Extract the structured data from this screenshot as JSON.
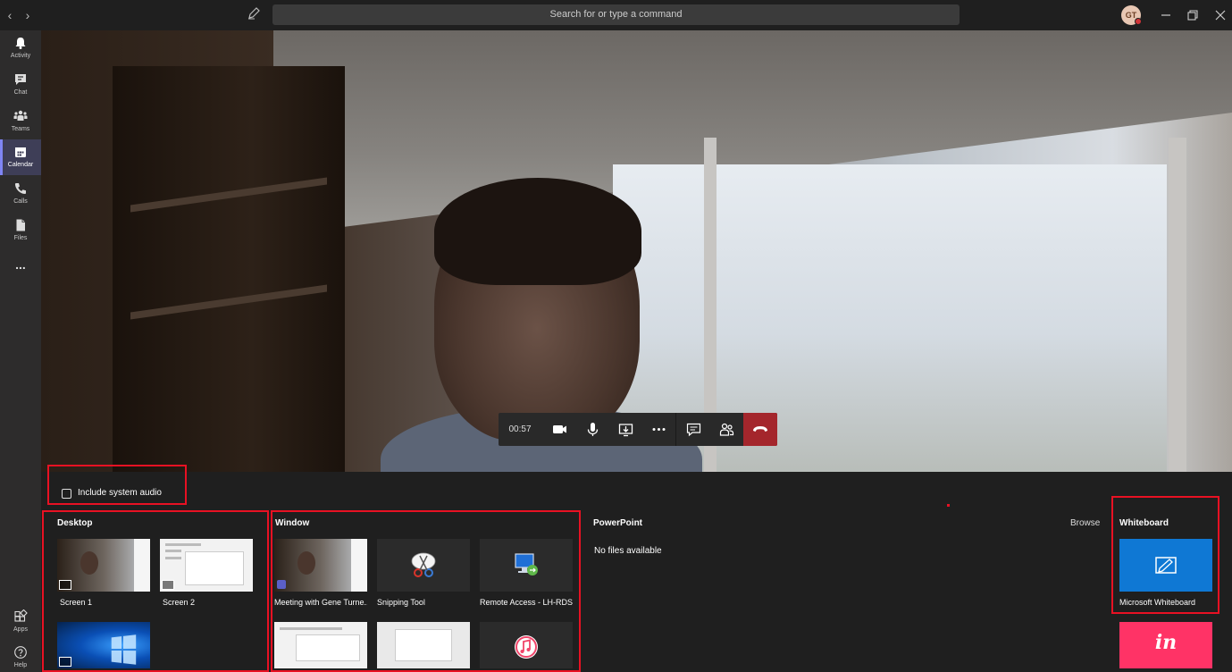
{
  "topbar": {
    "search_placeholder": "Search for or type a command",
    "avatar_initials": "GT"
  },
  "rail": {
    "items": [
      {
        "label": "Activity",
        "active": false
      },
      {
        "label": "Chat",
        "active": false
      },
      {
        "label": "Teams",
        "active": false
      },
      {
        "label": "Calendar",
        "active": true
      },
      {
        "label": "Calls",
        "active": false
      },
      {
        "label": "Files",
        "active": false
      }
    ],
    "more_label": "...",
    "apps_label": "Apps",
    "help_label": "Help"
  },
  "call": {
    "timer": "00:57"
  },
  "share": {
    "include_audio_label": "Include system audio",
    "desktop": {
      "title": "Desktop",
      "items": [
        {
          "label": "Screen 1"
        },
        {
          "label": "Screen 2"
        },
        {
          "label": ""
        }
      ]
    },
    "window": {
      "title": "Window",
      "items": [
        {
          "label": "Meeting with Gene Turne..."
        },
        {
          "label": "Snipping Tool"
        },
        {
          "label": "Remote Access - LH-RDS..."
        }
      ]
    },
    "powerpoint": {
      "title": "PowerPoint",
      "browse_label": "Browse",
      "empty_text": "No files available"
    },
    "whiteboard": {
      "title": "Whiteboard",
      "item_label": "Microsoft Whiteboard",
      "invision_text": "in"
    }
  },
  "colors": {
    "accent": "#7f85f5",
    "hangup": "#a4262c",
    "highlight": "#e81123",
    "whiteboard": "#0f78d4",
    "invision": "#ff3366"
  }
}
